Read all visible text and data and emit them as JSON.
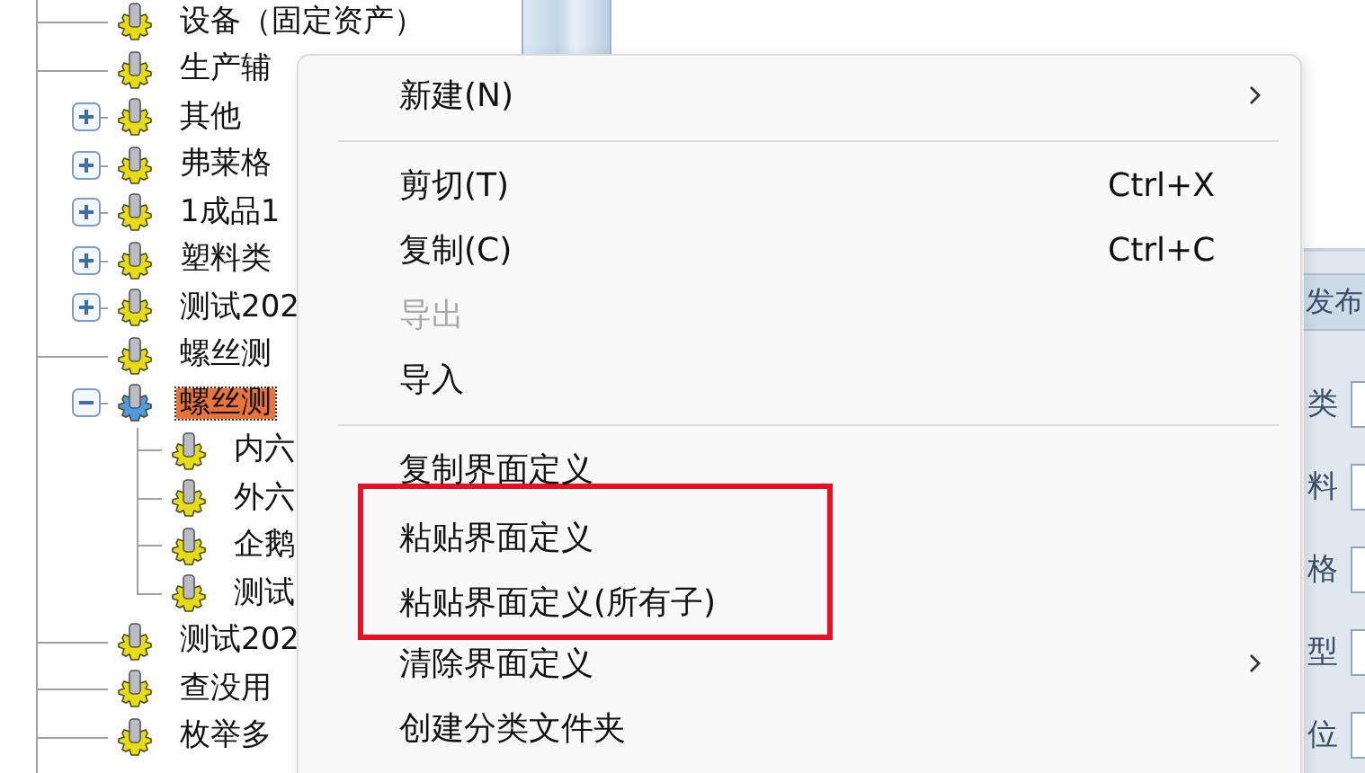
{
  "tree": {
    "items": [
      {
        "kind": "leaf",
        "label": "设备（固定资产）",
        "selected": false
      },
      {
        "kind": "leaf",
        "label": "生产辅",
        "selected": false
      },
      {
        "kind": "folder",
        "label": "其他",
        "expanded": false,
        "selected": false
      },
      {
        "kind": "folder",
        "label": "弗莱格",
        "expanded": false,
        "selected": false
      },
      {
        "kind": "folder",
        "label": "1成品1",
        "expanded": false,
        "selected": false
      },
      {
        "kind": "folder",
        "label": "塑料类",
        "expanded": false,
        "selected": false
      },
      {
        "kind": "folder",
        "label": "测试202",
        "expanded": false,
        "selected": false
      },
      {
        "kind": "leaf",
        "label": "螺丝测",
        "selected": false
      },
      {
        "kind": "folder",
        "label": "螺丝测",
        "expanded": true,
        "selected": true,
        "children": [
          {
            "kind": "leaf",
            "label": "内六",
            "selected": false
          },
          {
            "kind": "leaf",
            "label": "外六",
            "selected": false
          },
          {
            "kind": "leaf",
            "label": "企鹅",
            "selected": false
          },
          {
            "kind": "leaf",
            "label": "测试",
            "selected": false
          }
        ]
      },
      {
        "kind": "leaf",
        "label": "测试202",
        "selected": false
      },
      {
        "kind": "leaf",
        "label": "查没用",
        "selected": false
      },
      {
        "kind": "leaf",
        "label": "枚举多",
        "selected": false
      }
    ]
  },
  "context_menu": {
    "items": [
      {
        "kind": "item",
        "label": "新建(N)",
        "submenu": true,
        "disabled": false,
        "highlighted": false
      },
      {
        "kind": "separator"
      },
      {
        "kind": "item",
        "label": "剪切(T)",
        "shortcut": "Ctrl+X",
        "submenu": false,
        "disabled": false,
        "highlighted": false
      },
      {
        "kind": "item",
        "label": "复制(C)",
        "shortcut": "Ctrl+C",
        "submenu": false,
        "disabled": false,
        "highlighted": false
      },
      {
        "kind": "item",
        "label": "导出",
        "submenu": false,
        "disabled": true,
        "highlighted": false
      },
      {
        "kind": "item",
        "label": "导入",
        "submenu": false,
        "disabled": false,
        "highlighted": false
      },
      {
        "kind": "separator"
      },
      {
        "kind": "item",
        "label": "复制界面定义",
        "submenu": false,
        "disabled": false,
        "highlighted": false
      },
      {
        "kind": "item",
        "label": "粘贴界面定义",
        "submenu": false,
        "disabled": false,
        "highlighted": true
      },
      {
        "kind": "item",
        "label": "粘贴界面定义(所有子)",
        "submenu": false,
        "disabled": false,
        "highlighted": true
      },
      {
        "kind": "item",
        "label": "清除界面定义",
        "submenu": true,
        "disabled": false,
        "highlighted": false
      },
      {
        "kind": "item",
        "label": "创建分类文件夹",
        "submenu": false,
        "disabled": false,
        "highlighted": false
      }
    ]
  },
  "right_panel": {
    "tab": "发布",
    "labels": [
      "类",
      "料",
      "格",
      "型",
      "位"
    ]
  }
}
